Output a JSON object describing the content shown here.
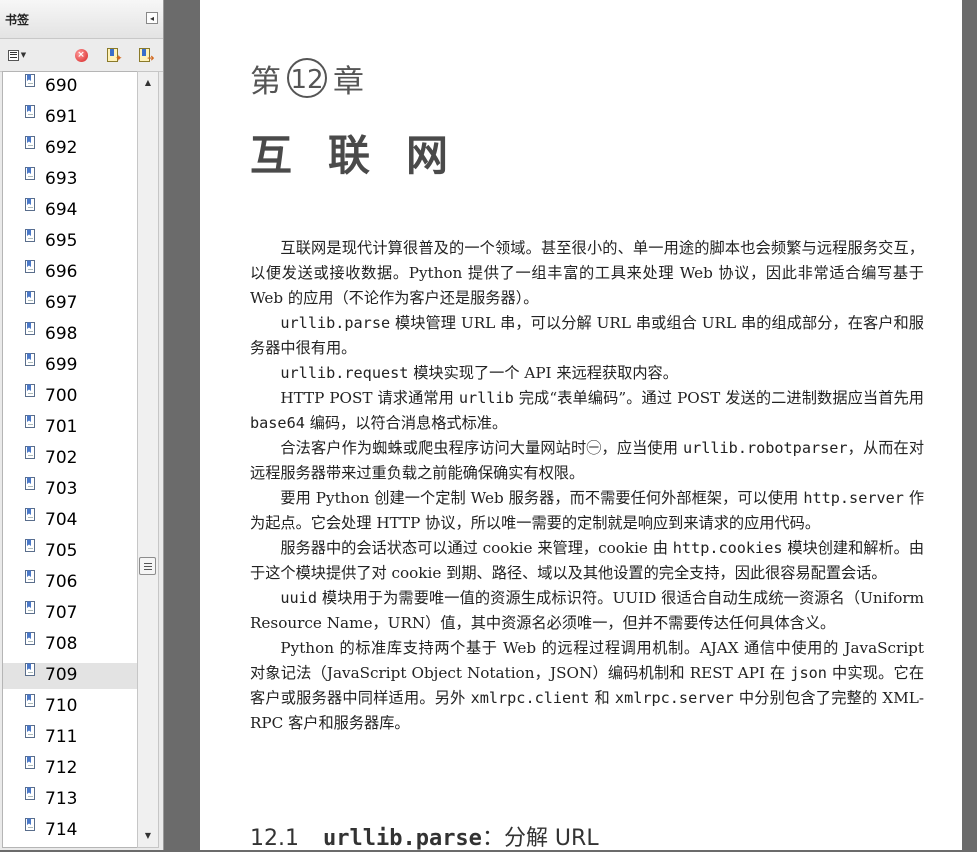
{
  "panel": {
    "title": "书签",
    "collapse_icon": "◂",
    "toolbar": {
      "options_icon": "bookmark-options-icon",
      "delete_icon": "delete-bookmark-icon",
      "new_icon": "new-bookmark-icon",
      "expand_icon": "expand-bookmark-icon"
    },
    "bookmarks": [
      {
        "label": "690"
      },
      {
        "label": "691"
      },
      {
        "label": "692"
      },
      {
        "label": "693"
      },
      {
        "label": "694"
      },
      {
        "label": "695"
      },
      {
        "label": "696"
      },
      {
        "label": "697"
      },
      {
        "label": "698"
      },
      {
        "label": "699"
      },
      {
        "label": "700"
      },
      {
        "label": "701"
      },
      {
        "label": "702"
      },
      {
        "label": "703"
      },
      {
        "label": "704"
      },
      {
        "label": "705"
      },
      {
        "label": "706"
      },
      {
        "label": "707"
      },
      {
        "label": "708"
      },
      {
        "label": "709"
      },
      {
        "label": "710"
      },
      {
        "label": "711"
      },
      {
        "label": "712"
      },
      {
        "label": "713"
      },
      {
        "label": "714"
      }
    ],
    "selected_bookmark": "709"
  },
  "document": {
    "chapter_prefix": "第",
    "chapter_number": "12",
    "chapter_suffix": "章",
    "chapter_title": "互联网",
    "paragraphs": [
      [
        {
          "t": "互联网是现代计算很普及的一个领域。甚至很小的、单一用途的脚本也会频繁与远程服务交互，以便发送或接收数据。Python 提供了一组丰富的工具来处理 Web 协议，因此非常适合编写基于 Web 的应用（不论作为客户还是服务器）。"
        }
      ],
      [
        {
          "t": "urllib.parse",
          "code": true
        },
        {
          "t": " 模块管理 URL 串，可以分解 URL 串或组合 URL 串的组成部分，在客户和服务器中很有用。"
        }
      ],
      [
        {
          "t": "urllib.request",
          "code": true
        },
        {
          "t": " 模块实现了一个 API 来远程获取内容。"
        }
      ],
      [
        {
          "t": "HTTP POST 请求通常用 "
        },
        {
          "t": "urllib",
          "code": true
        },
        {
          "t": " 完成“表单编码”。通过 POST 发送的二进制数据应当首先用 "
        },
        {
          "t": "base64",
          "code": true
        },
        {
          "t": " 编码，以符合消息格式标准。"
        }
      ],
      [
        {
          "t": "合法客户作为蜘蛛或爬虫程序访问大量网站时㊀，应当使用 "
        },
        {
          "t": "urllib.robotparser",
          "code": true
        },
        {
          "t": "，从而在对远程服务器带来过重负载之前能确保确实有权限。"
        }
      ],
      [
        {
          "t": "要用 Python 创建一个定制 Web 服务器，而不需要任何外部框架，可以使用 "
        },
        {
          "t": "http.server",
          "code": true
        },
        {
          "t": " 作为起点。它会处理 HTTP 协议，所以唯一需要的定制就是响应到来请求的应用代码。"
        }
      ],
      [
        {
          "t": "服务器中的会话状态可以通过 cookie 来管理，cookie 由 "
        },
        {
          "t": "http.cookies",
          "code": true
        },
        {
          "t": " 模块创建和解析。由于这个模块提供了对 cookie 到期、路径、域以及其他设置的完全支持，因此很容易配置会话。"
        }
      ],
      [
        {
          "t": "uuid",
          "code": true
        },
        {
          "t": " 模块用于为需要唯一值的资源生成标识符。UUID 很适合自动生成统一资源名（Uniform Resource Name，URN）值，其中资源名必须唯一，但并不需要传达任何具体含义。"
        }
      ],
      [
        {
          "t": "Python 的标准库支持两个基于 Web 的远程过程调用机制。AJAX 通信中使用的 JavaScript 对象记法（JavaScript Object Notation，JSON）编码机制和 REST API 在 "
        },
        {
          "t": "json",
          "code": true
        },
        {
          "t": " 中实现。它在客户或服务器中同样适用。另外 "
        },
        {
          "t": "xmlrpc.client",
          "code": true
        },
        {
          "t": " 和 "
        },
        {
          "t": "xmlrpc.server",
          "code": true
        },
        {
          "t": " 中分别包含了完整的 XML-RPC 客户和服务器库。"
        }
      ]
    ],
    "section": {
      "number": "12.1",
      "code": "urllib.parse",
      "rest": "：分解 URL"
    }
  }
}
